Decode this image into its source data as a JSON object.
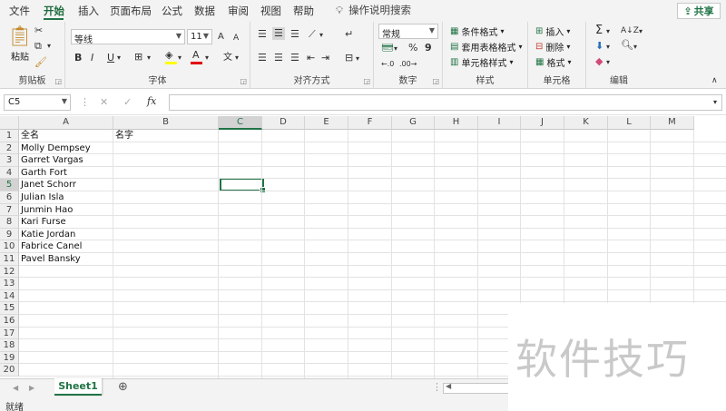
{
  "menu": {
    "tabs": [
      "文件",
      "开始",
      "插入",
      "页面布局",
      "公式",
      "数据",
      "审阅",
      "视图",
      "帮助"
    ],
    "tell_me": "操作说明搜索",
    "share": "共享"
  },
  "ribbon": {
    "clipboard": {
      "label": "剪贴板",
      "paste": "粘贴"
    },
    "font": {
      "label": "字体",
      "name": "等线",
      "size": "11",
      "bold": "B",
      "italic": "I",
      "underline": "U",
      "grow": "A",
      "shrink": "A",
      "phonetic": "文"
    },
    "alignment": {
      "label": "对齐方式"
    },
    "number": {
      "label": "数字",
      "format": "常规",
      "percent": "%",
      "comma": "9"
    },
    "styles": {
      "label": "样式",
      "conditional": "条件格式",
      "table": "套用表格格式",
      "cell_styles": "单元格样式"
    },
    "cells": {
      "label": "单元格",
      "insert": "插入",
      "delete": "删除",
      "format": "格式"
    },
    "editing": {
      "label": "编辑"
    }
  },
  "formula_bar": {
    "name_box": "C5",
    "formula": ""
  },
  "sheet": {
    "columns": [
      "A",
      "B",
      "C",
      "D",
      "E",
      "F",
      "G",
      "H",
      "I",
      "J",
      "K",
      "L",
      "M"
    ],
    "rows": [
      "1",
      "2",
      "3",
      "4",
      "5",
      "6",
      "7",
      "8",
      "9",
      "10",
      "11",
      "12",
      "13",
      "14",
      "15",
      "16",
      "17",
      "18",
      "19",
      "20"
    ],
    "selected_cell": "C5",
    "cells": {
      "A1": "全名",
      "B1": "名字",
      "A2": "Molly Dempsey",
      "A3": "Garret Vargas",
      "A4": "Garth Fort",
      "A5": "Janet Schorr",
      "A6": "Julian Isla",
      "A7": "Junmin Hao",
      "A8": "Kari Furse",
      "A9": "Katie Jordan",
      "A10": "Fabrice Canel",
      "A11": "Pavel Bansky"
    }
  },
  "sheet_tabs": {
    "active": "Sheet1"
  },
  "status": {
    "text": "就绪"
  },
  "watermark": "软件技巧",
  "colors": {
    "accent": "#217346"
  }
}
